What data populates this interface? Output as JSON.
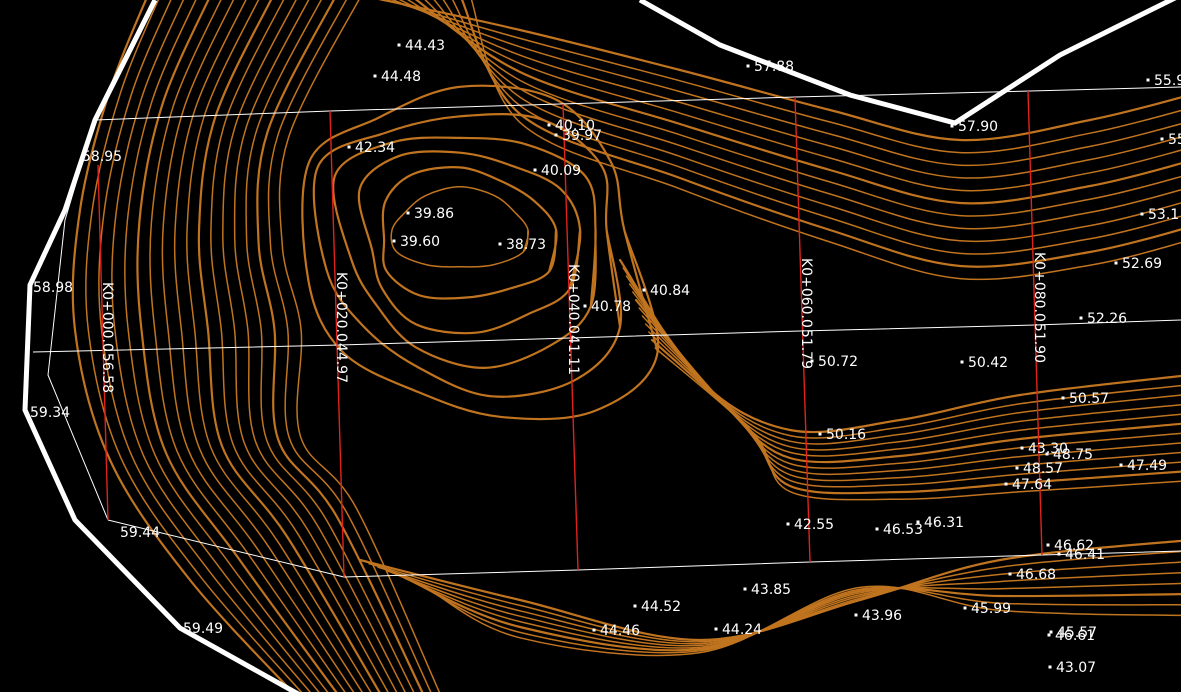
{
  "colors": {
    "background": "#000000",
    "contour": "#c0741f",
    "boundary": "#ffffff",
    "station_line": "#e0221c",
    "text": "#ffffff"
  },
  "stations": [
    {
      "label": "K0+000.0",
      "elev": "56.58"
    },
    {
      "label": "K0+020.0",
      "elev": "44.97"
    },
    {
      "label": "K0+040.0",
      "elev": "41.11"
    },
    {
      "label": "K0+060.0",
      "elev": "51.79"
    },
    {
      "label": "K0+080.0",
      "elev": "51.90"
    }
  ],
  "elevations": [
    "44.43",
    "44.48",
    "57.88",
    "55.9",
    "40.10",
    "39.97",
    "57.90",
    "58.95",
    "42.34",
    "55",
    "40.09",
    "39.86",
    "53.1",
    "39.60",
    "38.73",
    "52.69",
    "58.98",
    "40.78",
    "40.84",
    "52.26",
    "50.72",
    "50.42",
    "59.34",
    "50.57",
    "50.16",
    "43.30",
    "48.75",
    "48.57",
    "47.49",
    "47.64",
    "42.55",
    "46.53",
    "46.31",
    "59.44",
    "46.62",
    "46.41",
    "46.68",
    "43.85",
    "44.52",
    "45.99",
    "43.96",
    "44.46",
    "44.24",
    "45.57",
    "46.61",
    "59.49",
    "43.07"
  ]
}
